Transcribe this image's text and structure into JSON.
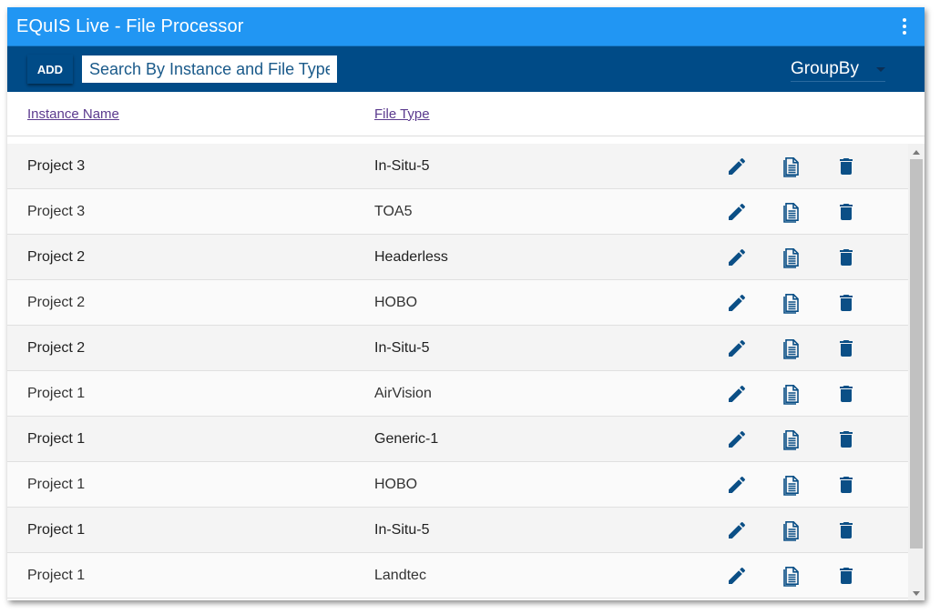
{
  "app": {
    "title": "EQuIS Live - File Processor",
    "menu_icon": "more-vert-icon"
  },
  "toolbar": {
    "add_label": "ADD",
    "search_placeholder": "Search By Instance and File Type",
    "search_value": "",
    "groupby_label": "GroupBy"
  },
  "columns": {
    "instance": "Instance Name",
    "file_type": "File Type"
  },
  "actions": {
    "edit_icon": "pencil-edit-icon",
    "doc_icon": "document-icon",
    "delete_icon": "trash-delete-icon"
  },
  "rows": [
    {
      "instance": "Project 3",
      "file_type": "In-Situ-5"
    },
    {
      "instance": "Project 3",
      "file_type": "TOA5"
    },
    {
      "instance": "Project 2",
      "file_type": "Headerless"
    },
    {
      "instance": "Project 2",
      "file_type": "HOBO"
    },
    {
      "instance": "Project 2",
      "file_type": "In-Situ-5"
    },
    {
      "instance": "Project 1",
      "file_type": "AirVision"
    },
    {
      "instance": "Project 1",
      "file_type": "Generic-1"
    },
    {
      "instance": "Project 1",
      "file_type": "HOBO"
    },
    {
      "instance": "Project 1",
      "file_type": "In-Situ-5"
    },
    {
      "instance": "Project 1",
      "file_type": "Landtec"
    }
  ],
  "colors": {
    "title_bar": "#2196f3",
    "toolbar": "#004b87",
    "icon": "#0b4f86",
    "link": "#5b3a8e"
  }
}
